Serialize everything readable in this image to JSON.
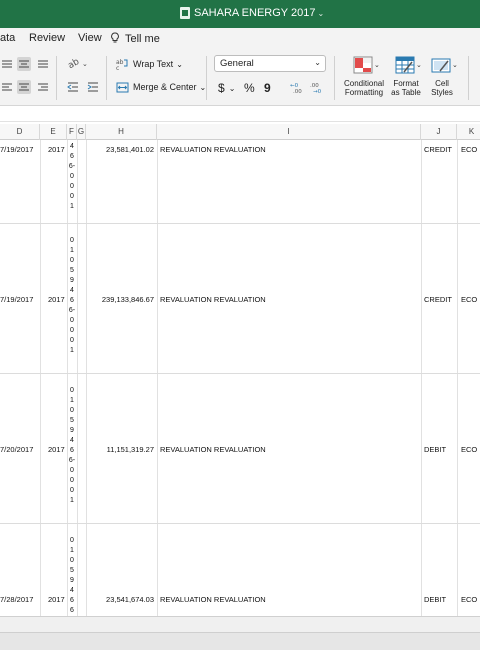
{
  "window": {
    "title": "SAHARA ENERGY 2017"
  },
  "menu": {
    "data_label": "ata",
    "review_label": "Review",
    "view_label": "View",
    "tell_me_label": "Tell me"
  },
  "ribbon": {
    "wrap_text_label": "Wrap Text",
    "merge_center_label": "Merge & Center",
    "number_format_value": "General",
    "currency_symbol": "$",
    "percent_symbol": "%",
    "comma_symbol": "9",
    "conditional_formatting_line1": "Conditional",
    "conditional_formatting_line2": "Formatting",
    "format_table_line1": "Format",
    "format_table_line2": "as Table",
    "cell_styles_line1": "Cell",
    "cell_styles_line2": "Styles"
  },
  "sheet": {
    "columns": [
      "D",
      "E",
      "F",
      "G",
      "H",
      "I",
      "J",
      "K"
    ],
    "rows": [
      {
        "date": "7/19/2017",
        "year": "2017",
        "code_digits": [
          "4",
          "6",
          "6-",
          "0",
          "0",
          "0",
          "1"
        ],
        "amount": "23,581,401.02",
        "description": "REVALUATION REVALUATION",
        "type": "CREDIT",
        "k": "ECO"
      },
      {
        "date": "7/19/2017",
        "year": "2017",
        "code_digits": [
          "0",
          "1",
          "0",
          "5",
          "9",
          "4",
          "6",
          "6-",
          "0",
          "0",
          "0",
          "1"
        ],
        "amount": "239,133,846.67",
        "description": "REVALUATION REVALUATION",
        "type": "CREDIT",
        "k": "ECO"
      },
      {
        "date": "7/20/2017",
        "year": "2017",
        "code_digits": [
          "0",
          "1",
          "0",
          "5",
          "9",
          "4",
          "6",
          "6-",
          "0",
          "0",
          "0",
          "1"
        ],
        "amount": "11,151,319.27",
        "description": "REVALUATION REVALUATION",
        "type": "DEBIT",
        "k": "ECO"
      },
      {
        "date": "7/28/2017",
        "year": "2017",
        "code_digits": [
          "0",
          "1",
          "0",
          "5",
          "9",
          "4",
          "6",
          "6"
        ],
        "amount": "23,541,674.03",
        "description": "REVALUATION REVALUATION",
        "type": "DEBIT",
        "k": "ECO"
      }
    ]
  }
}
